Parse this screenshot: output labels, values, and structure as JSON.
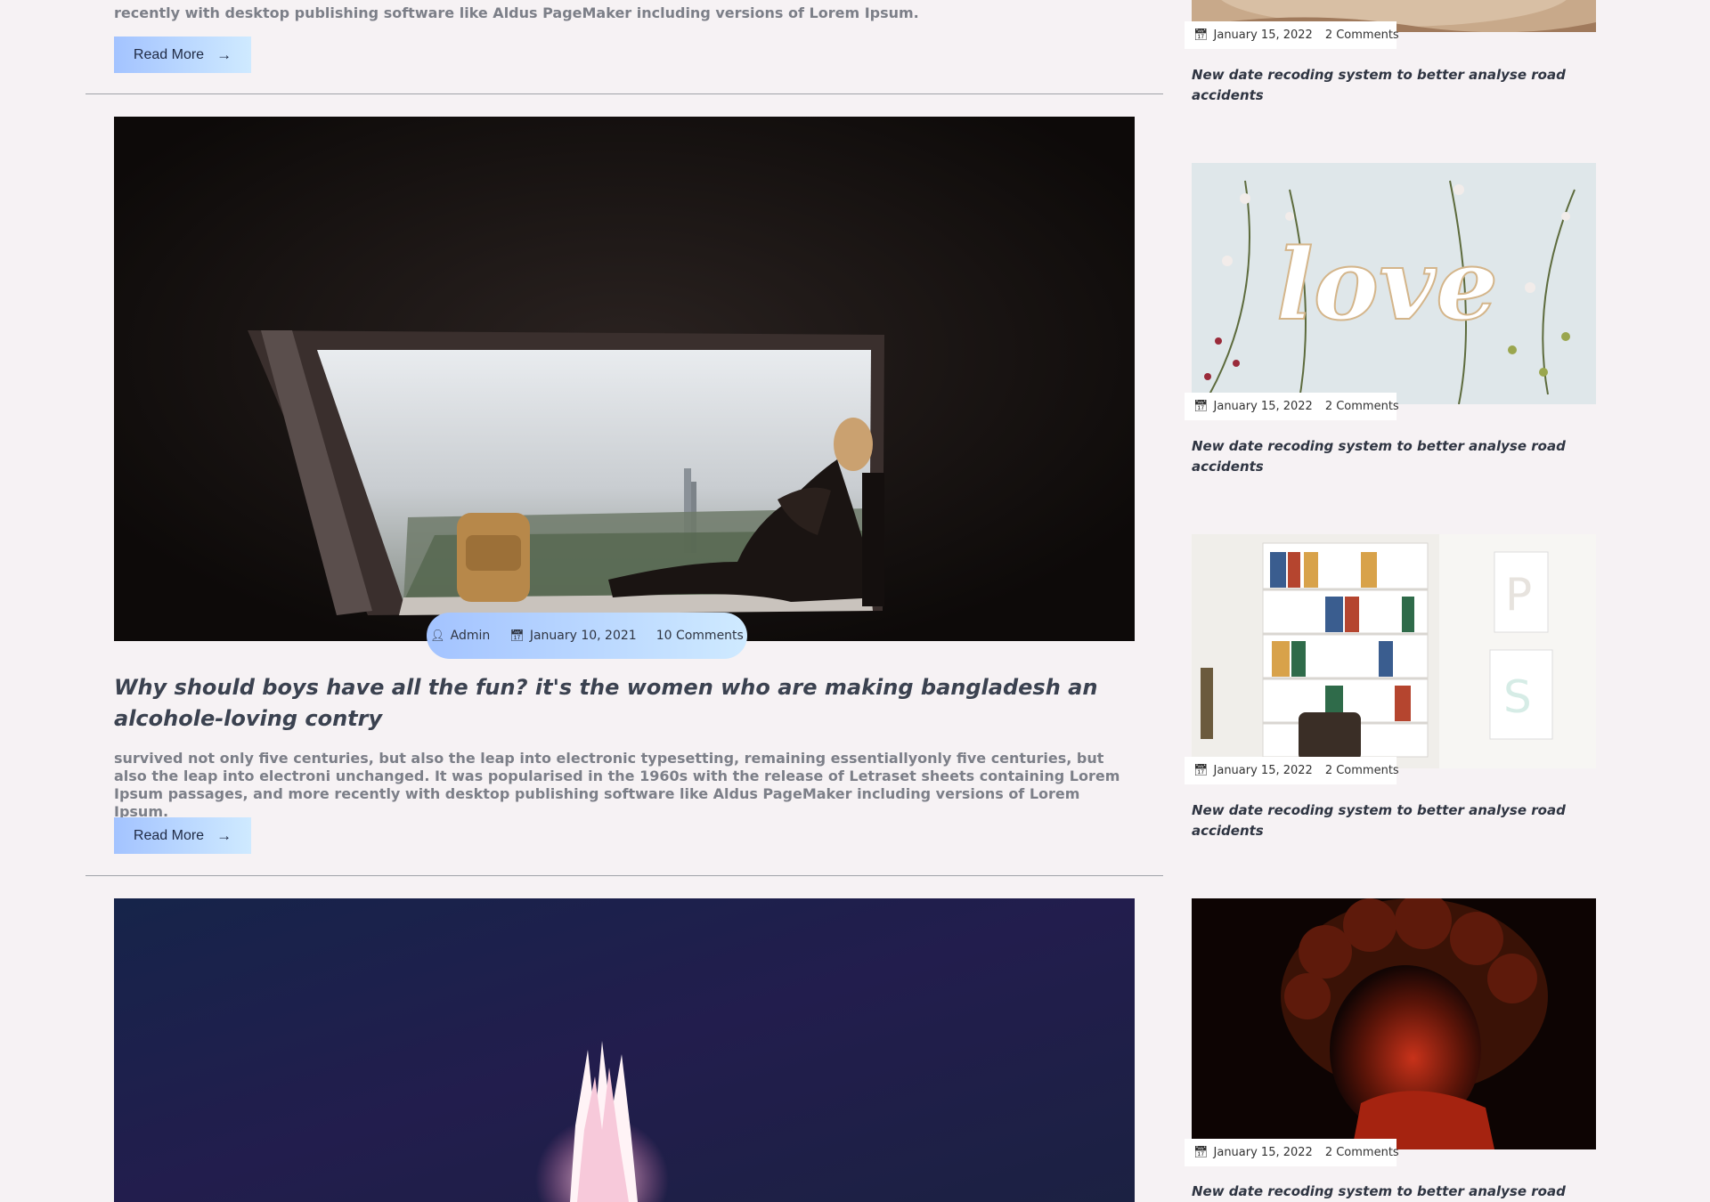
{
  "main": {
    "top_excerpt": "recently with desktop publishing software like Aldus PageMaker including versions of Lorem Ipsum.",
    "read_more_label": "Read More",
    "read_more_icon": "arrow-right-icon",
    "post": {
      "author": "Admin",
      "date": "January 10, 2021",
      "comments": "10 Comments",
      "title": "Why should boys have all the fun? it's the women who are making bangladesh an alcohole-loving contry",
      "excerpt": "survived not only five centuries, but also the leap into electronic typesetting, remaining essentiallyonly five centuries, but also the leap into electroni unchanged. It was popularised in the 1960s with the release of Letraset sheets containing Lorem Ipsum passages, and more recently with desktop publishing software like Aldus PageMaker including versions of Lorem Ipsum."
    }
  },
  "sidebar": {
    "posts": [
      {
        "date": "January 15, 2022",
        "comments": "2 Comments",
        "title": "New date recoding system to better analyse road accidents"
      },
      {
        "date": "January 15, 2022",
        "comments": "2 Comments",
        "title": "New date recoding system to better analyse road accidents"
      },
      {
        "date": "January 15, 2022",
        "comments": "2 Comments",
        "title": "New date recoding system to better analyse road accidents"
      },
      {
        "date": "January 15, 2022",
        "comments": "2 Comments",
        "title": "New date recoding system to better analyse road"
      }
    ]
  },
  "colors": {
    "page_bg": "#f6f2f4",
    "button_gradient_start": "#a3c3ff",
    "button_gradient_end": "#cfeaff",
    "title_text": "#3b4250"
  }
}
